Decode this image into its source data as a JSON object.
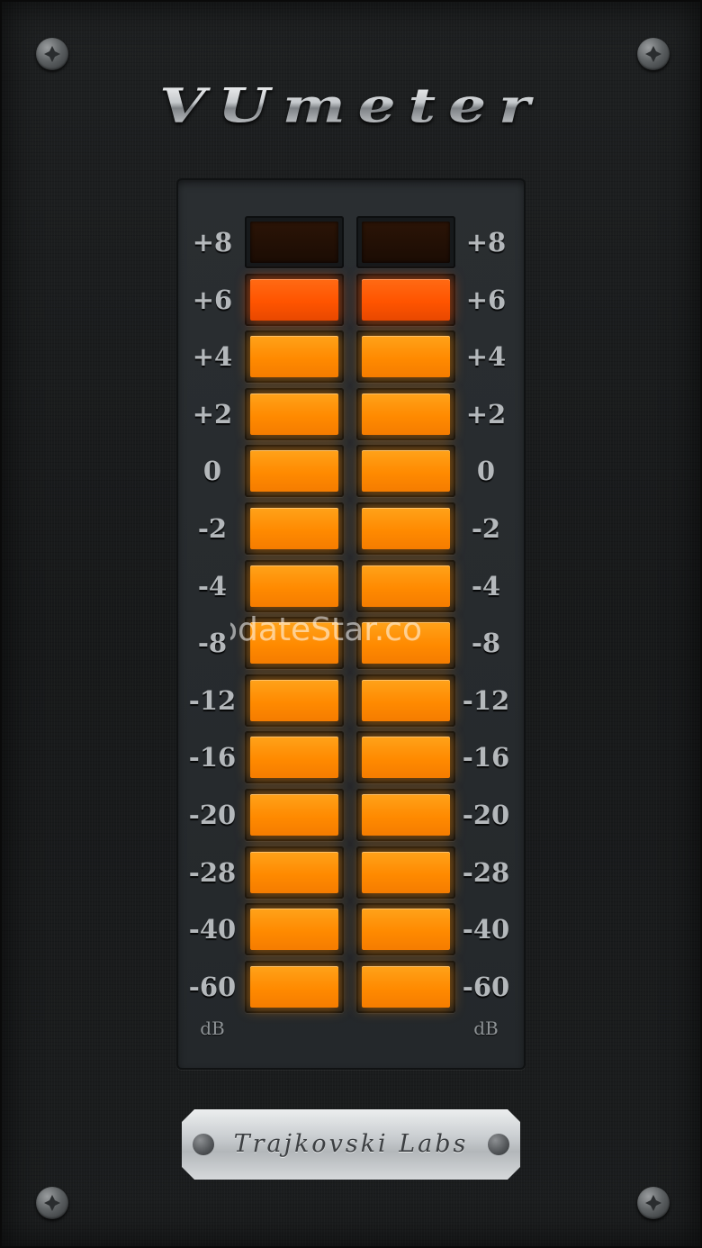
{
  "app": {
    "title": "VUmeter",
    "brand": "Trajkovski Labs",
    "watermark": "odateStar.co"
  },
  "meter": {
    "scale": [
      "+8",
      "+6",
      "+4",
      "+2",
      "0",
      "-2",
      "-4",
      "-8",
      "-12",
      "-16",
      "-20",
      "-28",
      "-40",
      "-60"
    ],
    "unit": "dB",
    "channels": [
      {
        "id": "left",
        "lit_segments": 13,
        "peak_segment": "+6"
      },
      {
        "id": "right",
        "lit_segments": 13,
        "peak_segment": "+6"
      }
    ]
  },
  "colors": {
    "segment_on": "#ff8a00",
    "segment_peak": "#ff5400",
    "segment_off": "#2b1406",
    "label": "#b4b8bb",
    "background": "#1b1d1e"
  },
  "icons": {
    "screw": "screw-icon"
  }
}
